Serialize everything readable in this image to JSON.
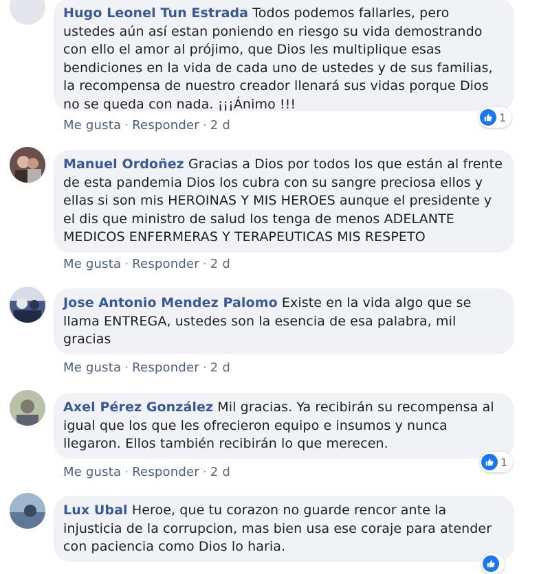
{
  "comments": [
    {
      "author": "Hugo Leonel Tun Estrada",
      "text": "Todos podemos fallarles, pero ustedes aún así estan poniendo en riesgo su vida demostrando con ello el amor al prójimo, que Dios les multiplique esas bendiciones en la vida de cada uno de ustedes y de sus familias, la recompensa de nuestro creador llenará sus vidas porque Dios no se queda con nada. ¡¡¡Ánimo !!!",
      "like": "Me gusta",
      "reply": "Responder",
      "time": "2 d",
      "reactions": "1"
    },
    {
      "author": "Manuel Ordoñez",
      "text": "Gracias a Dios por todos los que están al frente de esta pandemia Dios los cubra con su sangre preciosa ellos y ellas si son mis HEROINAS Y MIS HEROES aunque el presidente y el dis que ministro de salud los tenga de menos ADELANTE MEDICOS ENFERMERAS Y TERAPEUTICAS MIS RESPETO",
      "like": "Me gusta",
      "reply": "Responder",
      "time": "2 d"
    },
    {
      "author": "Jose Antonio Mendez Palomo",
      "text": "Existe en la vida algo que se llama ENTREGA, ustedes son la esencia de esa palabra, mil gracias",
      "like": "Me gusta",
      "reply": "Responder",
      "time": "2 d"
    },
    {
      "author": "Axel Pérez González",
      "text": "Mil gracias. Ya recibirán su recompensa al igual que los que les ofrecieron equipo e insumos y nunca llegaron. Ellos también recibirán lo que merecen.",
      "like": "Me gusta",
      "reply": "Responder",
      "time": "2 d",
      "reactions": "1"
    },
    {
      "author": "Lux Ubal",
      "text": "Heroe, que tu corazon no guarde rencor ante la injusticia de la corrupcion, mas bien usa ese coraje para atender con paciencia como Dios lo haria."
    }
  ],
  "icons": {
    "avatar": "avatar-photo",
    "reaction": "thumbs-up-icon"
  },
  "colors": {
    "author": "#385898",
    "bubble": "#f0f2f5",
    "like": "#1877f2"
  }
}
